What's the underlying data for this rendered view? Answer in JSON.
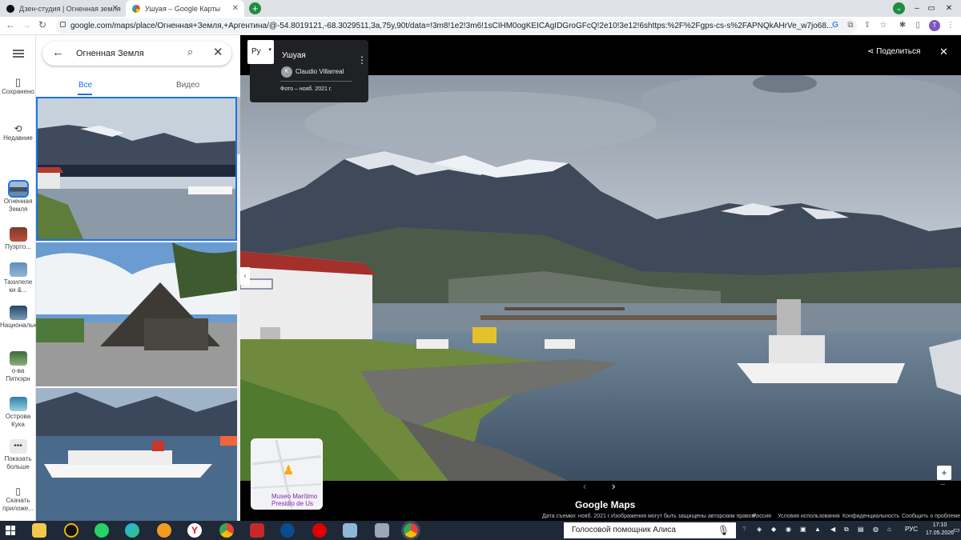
{
  "browser": {
    "tabs": [
      {
        "label": "Дзен-студия | Огненная земля",
        "active": false
      },
      {
        "label": "Ушуая – Google Карты",
        "active": true
      }
    ],
    "new_tab": "+",
    "window_controls": {
      "minimize": "–",
      "restore": "▭",
      "close": "✕"
    },
    "profile_letter": "T",
    "url": "google.com/maps/place/Огненная+Земля,+Аргентина/@-54.8019121,-68.3029511,3a,75y,90t/data=!3m8!1e2!3m6!1sCIHM0ogKEICAgIDGroGFcQ!2e10!3e12!6shttps:%2F%2Fgps-cs-s%2FAPNQkAHrVe_w7jo68..."
  },
  "rail": {
    "items": [
      {
        "label": "Сохранено",
        "icon": "bookmark-icon"
      },
      {
        "label": "Недавние",
        "icon": "history-icon"
      },
      {
        "label": "Огненная Земля",
        "icon": "place-thumb"
      },
      {
        "label": "Пуэрто...",
        "icon": "place-thumb"
      },
      {
        "label": "Тахилеле ки &...",
        "icon": "place-thumb"
      },
      {
        "label": "Национальный...",
        "icon": "place-thumb"
      },
      {
        "label": "о-ва Питкэрн",
        "icon": "place-thumb"
      },
      {
        "label": "Острова Кука",
        "icon": "place-thumb"
      },
      {
        "label": "Показать больше",
        "icon": "more-icon"
      },
      {
        "label": "Скачать приложе...",
        "icon": "phone-icon"
      }
    ]
  },
  "panel": {
    "search_query": "Огненная Земля",
    "tabs": [
      {
        "label": "Все",
        "selected": true
      },
      {
        "label": "Видео",
        "selected": false
      }
    ]
  },
  "viewer": {
    "type_button": "Ру",
    "place_title": "Ушуая",
    "author_initial": "K",
    "author": "Claudio Villarreal",
    "photo_date": "Фото – нояб. 2021 г.",
    "share_label": "Поделиться",
    "logo": "Google Maps",
    "minimap_label": "Museo Marítimo Presidio de Us",
    "footer": {
      "capture": "Дата съемки: нояб. 2021 г.",
      "copyright": "Изображения могут быть защищены авторским правом.",
      "country": "Россия",
      "terms": "Условия использования",
      "privacy": "Конфиденциальность",
      "report": "Сообщить о проблеме"
    }
  },
  "taskbar": {
    "assistant": "Голосовой помощник Алиса",
    "lang": "РУС",
    "time": "17:10",
    "date": "17.05.2026"
  },
  "colors": {
    "accent": "#1a73e8",
    "chrome_bg": "#dee1e6",
    "taskbar": "#1e2837"
  }
}
